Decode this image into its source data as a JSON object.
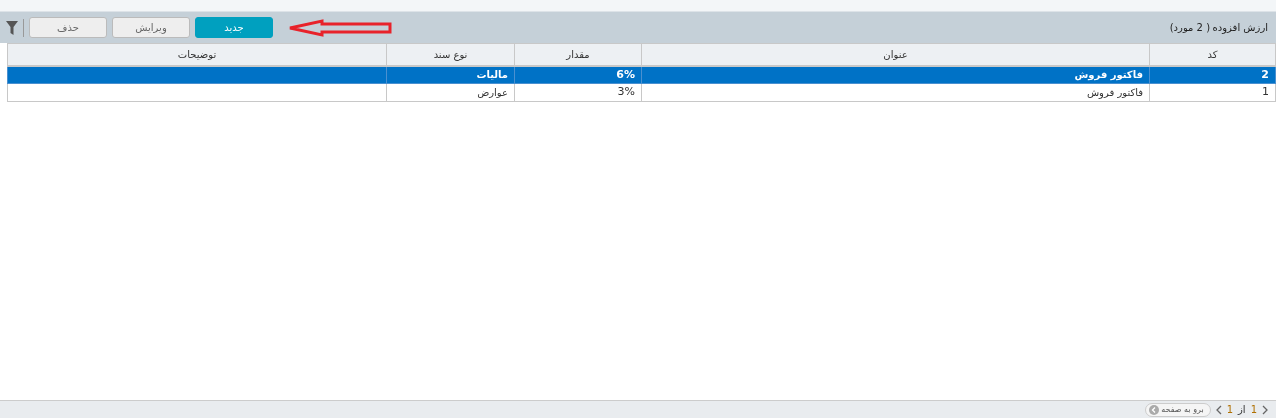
{
  "toolbar": {
    "title": "ارزش افزوده",
    "count": "( 2 مورد)",
    "buttons": [
      {
        "label": "جدید",
        "kind": "primary"
      },
      {
        "label": "ویرایش",
        "kind": "secondary"
      },
      {
        "label": "حذف",
        "kind": "secondary"
      }
    ]
  },
  "table": {
    "columns": [
      "کد",
      "عنوان",
      "مقدار",
      "نوع سند",
      "توضیحات"
    ],
    "rows": [
      {
        "selected": true,
        "cells": [
          "2",
          "فاکتور فروش",
          "6%",
          "مالیات",
          ""
        ]
      },
      {
        "selected": false,
        "cells": [
          "1",
          "فاکتور فروش",
          "3%",
          "عوارض",
          ""
        ]
      }
    ]
  },
  "pager": {
    "page": "1",
    "of": "از",
    "total": "1",
    "goto": "برو به صفحه"
  }
}
